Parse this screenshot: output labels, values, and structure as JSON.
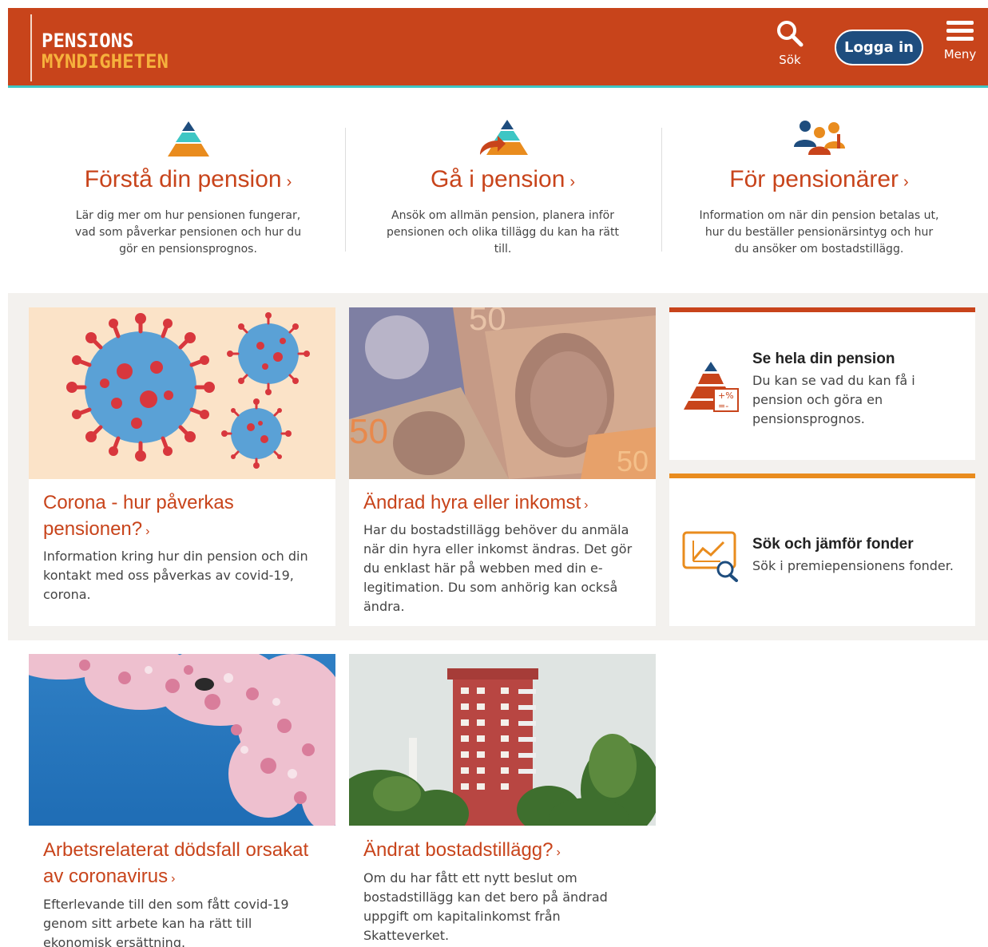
{
  "header": {
    "logo_line1": "PENSIONS",
    "logo_line2": "MYNDIGHETEN",
    "search_label": "Sök",
    "login_label": "Logga in",
    "menu_label": "Meny",
    "bg_color": "#c8441b",
    "accent_color": "#3ec6c4"
  },
  "features": [
    {
      "title": "Förstå din pension",
      "chevron": "›",
      "description": "Lär dig mer om hur pensionen fungerar, vad som påverkar pensionen och hur du gör en pensionsprognos.",
      "icon": "pyramid-icon"
    },
    {
      "title": "Gå i pension",
      "chevron": "›",
      "description": "Ansök om allmän pension, planera inför pensionen och olika tillägg du kan ha rätt till.",
      "icon": "pyramid-arrow-icon"
    },
    {
      "title": "För pensionärer",
      "chevron": "›",
      "description": "Information om när din pension betalas ut, hur du beställer pensionärsintyg och hur du ansöker om bostadstillägg.",
      "icon": "people-icon"
    }
  ],
  "cards": [
    {
      "title": "Corona - hur påverkas pensionen?",
      "chevron": "›",
      "text": "Information kring hur din pension och din kontakt med oss påverkas av covid-19, corona.",
      "image": "coronavirus-illustration"
    },
    {
      "title": "Ändrad hyra eller inkomst",
      "chevron": "›",
      "text": "Har du bostadstillägg behöver du anmäla när din hyra eller inkomst ändras. Det gör du enklast här på webben med din e-legitimation. Du som anhörig kan också ändra.",
      "image": "banknotes-photo"
    }
  ],
  "side_cards": [
    {
      "title": "Se hela din pension",
      "text": "Du kan se vad du kan få i pension och göra en pensionsprognos.",
      "icon": "pyramid-calculator-icon",
      "border_color": "#c8441b"
    },
    {
      "title": "Sök och jämför fonder",
      "text": "Sök i premiepensionens fonder.",
      "icon": "chart-search-icon",
      "border_color": "#e98c1e"
    }
  ],
  "bottom_cards": [
    {
      "title": "Arbetsrelaterat dödsfall orsakat av coronavirus",
      "chevron": "›",
      "text": "Efterlevande till den som fått covid-19 genom sitt arbete kan ha rätt till ekonomisk ersättning.",
      "image": "cherry-blossom-photo"
    },
    {
      "title": "Ändrat bostadstillägg?",
      "chevron": "›",
      "text": "Om du har fått ett nytt beslut om bostadstillägg kan det bero på ändrad uppgift om kapitalinkomst från Skatteverket.",
      "image": "apartment-building-photo"
    }
  ]
}
